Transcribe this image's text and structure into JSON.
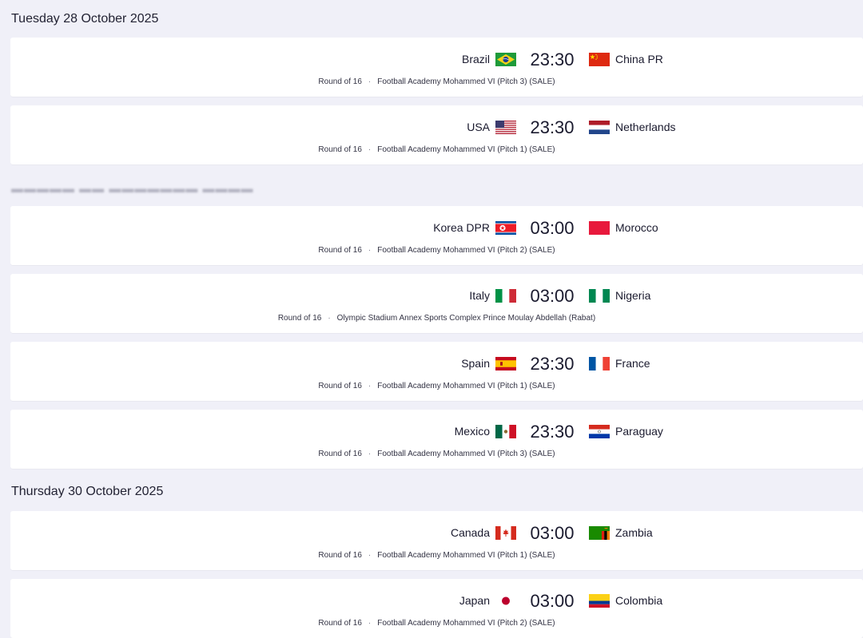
{
  "groups": [
    {
      "date": "Tuesday 28 October 2025",
      "matches": [
        {
          "home": "Brazil",
          "home_flag": "brazil-flag-icon",
          "time": "23:30",
          "away": "China PR",
          "away_flag": "china-flag-icon",
          "round": "Round of 16",
          "venue": "Football Academy Mohammed VI (Pitch 3) (SALE)"
        },
        {
          "home": "USA",
          "home_flag": "usa-flag-icon",
          "time": "23:30",
          "away": "Netherlands",
          "away_flag": "netherlands-flag-icon",
          "round": "Round of 16",
          "venue": "Football Academy Mohammed VI (Pitch 1) (SALE)"
        }
      ]
    },
    {
      "date": "",
      "matches": [
        {
          "home": "Korea DPR",
          "home_flag": "korea-dpr-flag-icon",
          "time": "03:00",
          "away": "Morocco",
          "away_flag": "morocco-flag-icon",
          "round": "Round of 16",
          "venue": "Football Academy Mohammed VI (Pitch 2) (SALE)"
        },
        {
          "home": "Italy",
          "home_flag": "italy-flag-icon",
          "time": "03:00",
          "away": "Nigeria",
          "away_flag": "nigeria-flag-icon",
          "round": "Round of 16",
          "venue": "Olympic Stadium Annex Sports Complex Prince Moulay Abdellah (Rabat)"
        },
        {
          "home": "Spain",
          "home_flag": "spain-flag-icon",
          "time": "23:30",
          "away": "France",
          "away_flag": "france-flag-icon",
          "round": "Round of 16",
          "venue": "Football Academy Mohammed VI (Pitch 1) (SALE)"
        },
        {
          "home": "Mexico",
          "home_flag": "mexico-flag-icon",
          "time": "23:30",
          "away": "Paraguay",
          "away_flag": "paraguay-flag-icon",
          "round": "Round of 16",
          "venue": "Football Academy Mohammed VI (Pitch 3) (SALE)"
        }
      ]
    },
    {
      "date": "Thursday 30 October 2025",
      "matches": [
        {
          "home": "Canada",
          "home_flag": "canada-flag-icon",
          "time": "03:00",
          "away": "Zambia",
          "away_flag": "zambia-flag-icon",
          "round": "Round of 16",
          "venue": "Football Academy Mohammed VI (Pitch 1) (SALE)"
        },
        {
          "home": "Japan",
          "home_flag": "japan-flag-icon",
          "time": "03:00",
          "away": "Colombia",
          "away_flag": "colombia-flag-icon",
          "round": "Round of 16",
          "venue": "Football Academy Mohammed VI (Pitch 2) (SALE)"
        }
      ]
    }
  ]
}
